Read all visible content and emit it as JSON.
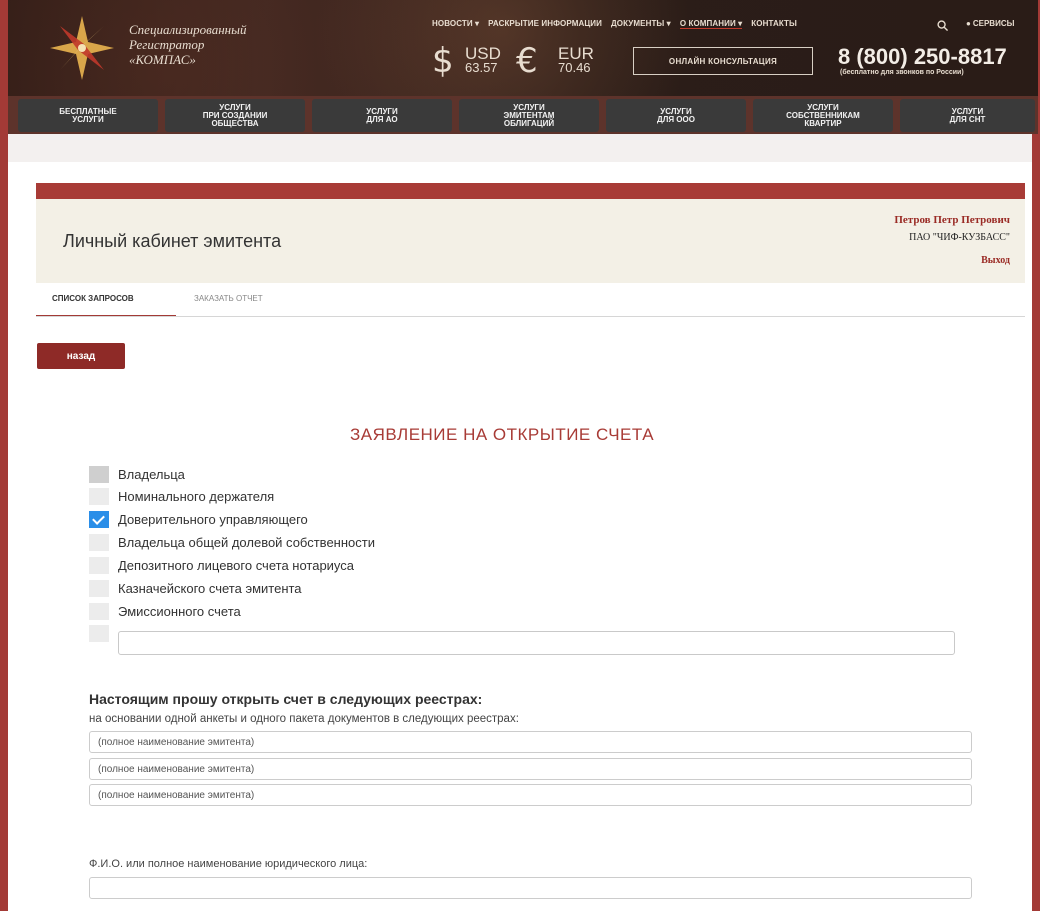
{
  "header": {
    "brand_line1": "Специализированный",
    "brand_line2": "Регистратор",
    "brand_line3": "«КОМПАС»",
    "nav": [
      "НОВОСТИ ▾",
      "РАСКРЫТИЕ ИНФОРМАЦИИ",
      "ДОКУМЕНТЫ ▾",
      "О КОМПАНИИ ▾",
      "КОНТАКТЫ"
    ],
    "services_label": "СЕРВИСЫ",
    "usd_symbol": "$",
    "usd_code": "USD",
    "usd_value": "63.57",
    "eur_symbol": "€",
    "eur_code": "EUR",
    "eur_value": "70.46",
    "consult_label": "ОНЛАЙН КОНСУЛЬТАЦИЯ",
    "phone": "8 (800) 250-8817",
    "phone_note": "(бесплатно для звонков по России)"
  },
  "service_tabs": [
    "БЕСПЛАТНЫЕ\nУСЛУГИ",
    "УСЛУГИ\nПРИ СОЗДАНИИ\nОБЩЕСТВА",
    "УСЛУГИ\nДЛЯ АО",
    "УСЛУГИ\nЭМИТЕНТАМ\nОБЛИГАЦИЙ",
    "УСЛУГИ\nДЛЯ ООО",
    "УСЛУГИ\nСОБСТВЕННИКАМ\nКВАРТИР",
    "УСЛУГИ\nДЛЯ СНТ"
  ],
  "cabinet": {
    "title": "Личный кабинет эмитента",
    "user_name": "Петров Петр Петрович",
    "organization": "ПАО \"ЧИФ-КУЗБАСС\"",
    "logout": "Выход"
  },
  "tabs": {
    "requests": "СПИСОК ЗАПРОСОВ",
    "order_report": "ЗАКАЗАТЬ ОТЧЕТ"
  },
  "back_button": "назад",
  "form": {
    "title": "ЗАЯВЛЕНИЕ НА ОТКРЫТИЕ СЧЕТА",
    "account_types": [
      {
        "label": "Владельца",
        "checked": false
      },
      {
        "label": "Номинального держателя",
        "checked": false
      },
      {
        "label": "Доверительного управляющего",
        "checked": true
      },
      {
        "label": "Владельца общей долевой собственности",
        "checked": false
      },
      {
        "label": "Депозитного лицевого счета нотариуса",
        "checked": false
      },
      {
        "label": "Казначейского счета эмитента",
        "checked": false
      },
      {
        "label": "Эмиссионного счета",
        "checked": false
      }
    ],
    "other_value": "",
    "registries_title": "Настоящим прошу открыть счет в следующих реестрах:",
    "registries_subtitle": "на основании одной анкеты и одного пакета документов в следующих реестрах:",
    "registry_placeholder": "(полное наименование эмитента)",
    "fio_label": "Ф.И.О. или полное наименование юридического лица:",
    "fio_value": ""
  }
}
